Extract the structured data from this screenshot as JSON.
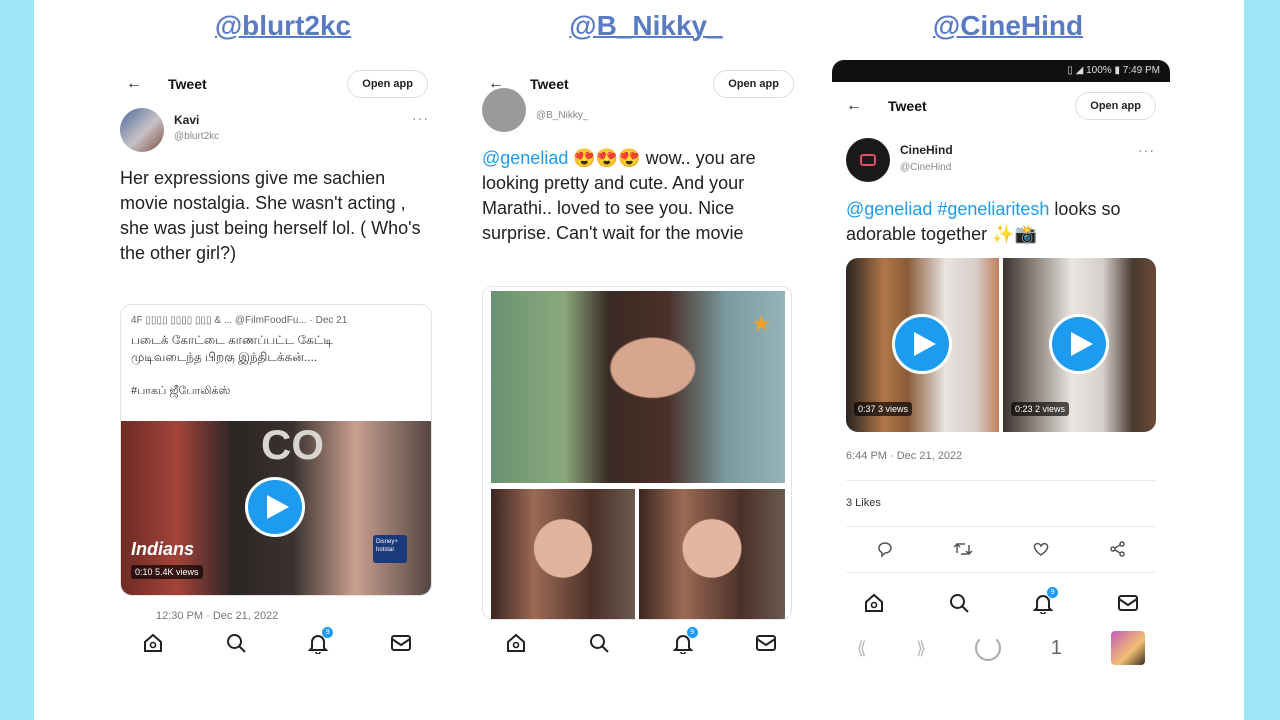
{
  "panels": [
    {
      "handle": "@blurt2kc",
      "topbar": {
        "title": "Tweet",
        "open_app": "Open app"
      },
      "author": {
        "name": "Kavi",
        "handle": "@blurt2kc"
      },
      "text": "Her expressions give me sachien movie nostalgia. She wasn't acting , she was just being herself lol. ( Who's the other girl?)",
      "quote": {
        "header": "4F ▯▯▯▯ ▯▯▯▯ ▯▯▯ & ... @FilmFoodFu... · Dec 21",
        "line1": "படைக் கோட்டை காணப்பட்ட கேட்டி",
        "line2": "முடிவடைந்த பிறகு இந்திடக்கன்....",
        "line3": "#பாகப் ஜீபோலிக்ஸ்",
        "video_caption": "Indians",
        "video_stats": "0:10   5.4K views",
        "video_brand": "Disney+ hotstar"
      },
      "footer_meta": "12:30 PM · Dec 21, 2022",
      "notif_count": "9"
    },
    {
      "handle": "@B_Nikky_",
      "topbar": {
        "title": "Tweet",
        "open_app": "Open app"
      },
      "author": {
        "handle": "@B_Nikky_"
      },
      "text_mention": "@geneliad",
      "text_emoji": "😍😍😍",
      "text_rest": " wow.. you are looking pretty and cute. And your Marathi.. loved to see you. Nice surprise. Can't wait for the movie",
      "notif_count": "9"
    },
    {
      "handle": "@CineHind",
      "status_bar": "▯ ◢ 100% ▮ 7:49 PM",
      "topbar": {
        "title": "Tweet",
        "open_app": "Open app"
      },
      "author": {
        "name": "CineHind",
        "handle": "@CineHind"
      },
      "text_mention": "@geneliad #geneliaritesh",
      "text_rest": " looks so adorable together ✨📸",
      "videos": [
        {
          "duration": "0:37",
          "views": "3 views"
        },
        {
          "duration": "0:23",
          "views": "2 views"
        }
      ],
      "timestamp": "6:44 PM · Dec 21, 2022",
      "likes": "3 Likes",
      "notif_count": "9",
      "android_nav": {
        "page": "1"
      }
    }
  ],
  "colors": {
    "accent": "#1d9bf0",
    "handle_link": "#5a7bc4",
    "background": "#9ee6f7"
  },
  "icons": {
    "home": "home-icon",
    "search": "search-icon",
    "notifications": "bell-icon",
    "messages": "mail-icon"
  }
}
